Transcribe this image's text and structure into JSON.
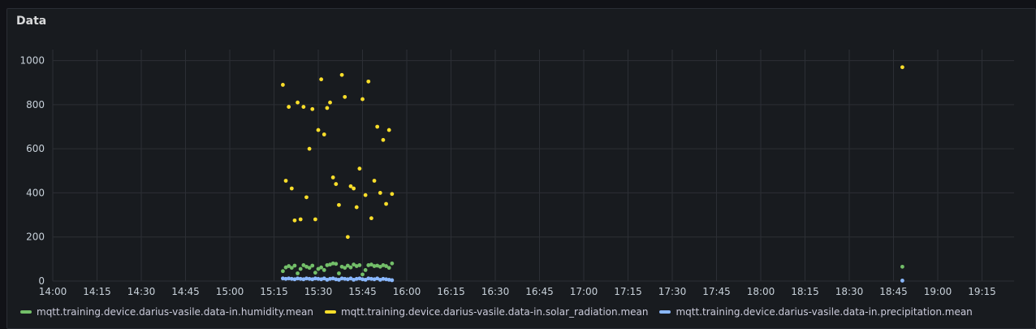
{
  "panel": {
    "title": "Data"
  },
  "chart_data": {
    "type": "scatter",
    "title": "Data",
    "xlabel": "",
    "ylabel": "",
    "ylim": [
      0,
      1050
    ],
    "xlim_minutes_labels": [
      "14:00",
      "19:25"
    ],
    "x_ticks": [
      "14:00",
      "14:15",
      "14:30",
      "14:45",
      "15:00",
      "15:15",
      "15:30",
      "15:45",
      "16:00",
      "16:15",
      "16:30",
      "16:45",
      "17:00",
      "17:15",
      "17:30",
      "17:45",
      "18:00",
      "18:15",
      "18:30",
      "18:45",
      "19:00",
      "19:15"
    ],
    "y_ticks": [
      0,
      200,
      400,
      600,
      800,
      1000
    ],
    "grid": true,
    "legend_position": "bottom-left",
    "series": [
      {
        "name": "mqtt.training.device.darius-vasile.data-in.humidity.mean",
        "color": "#73bf69",
        "points": [
          [
            "15:18",
            45
          ],
          [
            "15:19",
            62
          ],
          [
            "15:20",
            68
          ],
          [
            "15:21",
            60
          ],
          [
            "15:22",
            70
          ],
          [
            "15:23",
            35
          ],
          [
            "15:24",
            55
          ],
          [
            "15:25",
            72
          ],
          [
            "15:26",
            65
          ],
          [
            "15:27",
            60
          ],
          [
            "15:28",
            70
          ],
          [
            "15:29",
            38
          ],
          [
            "15:30",
            55
          ],
          [
            "15:31",
            62
          ],
          [
            "15:32",
            50
          ],
          [
            "15:33",
            72
          ],
          [
            "15:34",
            75
          ],
          [
            "15:35",
            80
          ],
          [
            "15:36",
            78
          ],
          [
            "15:37",
            35
          ],
          [
            "15:38",
            65
          ],
          [
            "15:39",
            60
          ],
          [
            "15:40",
            70
          ],
          [
            "15:41",
            62
          ],
          [
            "15:42",
            75
          ],
          [
            "15:43",
            68
          ],
          [
            "15:44",
            72
          ],
          [
            "15:45",
            30
          ],
          [
            "15:46",
            50
          ],
          [
            "15:47",
            72
          ],
          [
            "15:48",
            75
          ],
          [
            "15:49",
            68
          ],
          [
            "15:50",
            70
          ],
          [
            "15:51",
            65
          ],
          [
            "15:52",
            72
          ],
          [
            "15:53",
            68
          ],
          [
            "15:54",
            60
          ],
          [
            "15:55",
            80
          ],
          [
            "18:48",
            65
          ]
        ]
      },
      {
        "name": "mqtt.training.device.darius-vasile.data-in.solar_radiation.mean",
        "color": "#fade2a",
        "points": [
          [
            "15:18",
            890
          ],
          [
            "15:19",
            455
          ],
          [
            "15:20",
            790
          ],
          [
            "15:21",
            420
          ],
          [
            "15:22",
            275
          ],
          [
            "15:23",
            810
          ],
          [
            "15:24",
            280
          ],
          [
            "15:25",
            790
          ],
          [
            "15:26",
            380
          ],
          [
            "15:27",
            600
          ],
          [
            "15:28",
            780
          ],
          [
            "15:29",
            280
          ],
          [
            "15:30",
            685
          ],
          [
            "15:31",
            915
          ],
          [
            "15:32",
            665
          ],
          [
            "15:33",
            785
          ],
          [
            "15:34",
            810
          ],
          [
            "15:35",
            470
          ],
          [
            "15:36",
            440
          ],
          [
            "15:37",
            345
          ],
          [
            "15:38",
            935
          ],
          [
            "15:39",
            835
          ],
          [
            "15:40",
            200
          ],
          [
            "15:41",
            430
          ],
          [
            "15:42",
            420
          ],
          [
            "15:43",
            335
          ],
          [
            "15:44",
            510
          ],
          [
            "15:45",
            825
          ],
          [
            "15:46",
            390
          ],
          [
            "15:47",
            905
          ],
          [
            "15:48",
            285
          ],
          [
            "15:49",
            455
          ],
          [
            "15:50",
            700
          ],
          [
            "15:51",
            400
          ],
          [
            "15:52",
            640
          ],
          [
            "15:53",
            350
          ],
          [
            "15:54",
            685
          ],
          [
            "15:55",
            395
          ],
          [
            "18:48",
            970
          ]
        ]
      },
      {
        "name": "mqtt.training.device.darius-vasile.data-in.precipitation.mean",
        "color": "#8ab8ff",
        "points": [
          [
            "15:18",
            12
          ],
          [
            "15:19",
            10
          ],
          [
            "15:20",
            12
          ],
          [
            "15:21",
            10
          ],
          [
            "15:22",
            8
          ],
          [
            "15:23",
            12
          ],
          [
            "15:24",
            10
          ],
          [
            "15:25",
            8
          ],
          [
            "15:26",
            12
          ],
          [
            "15:27",
            10
          ],
          [
            "15:28",
            8
          ],
          [
            "15:29",
            12
          ],
          [
            "15:30",
            10
          ],
          [
            "15:31",
            8
          ],
          [
            "15:32",
            12
          ],
          [
            "15:33",
            6
          ],
          [
            "15:34",
            10
          ],
          [
            "15:35",
            12
          ],
          [
            "15:36",
            8
          ],
          [
            "15:37",
            6
          ],
          [
            "15:38",
            12
          ],
          [
            "15:39",
            10
          ],
          [
            "15:40",
            8
          ],
          [
            "15:41",
            12
          ],
          [
            "15:42",
            6
          ],
          [
            "15:43",
            10
          ],
          [
            "15:44",
            12
          ],
          [
            "15:45",
            8
          ],
          [
            "15:46",
            6
          ],
          [
            "15:47",
            12
          ],
          [
            "15:48",
            10
          ],
          [
            "15:49",
            8
          ],
          [
            "15:50",
            12
          ],
          [
            "15:51",
            6
          ],
          [
            "15:52",
            10
          ],
          [
            "15:53",
            8
          ],
          [
            "15:54",
            6
          ],
          [
            "15:55",
            4
          ],
          [
            "18:48",
            2
          ]
        ]
      }
    ]
  }
}
